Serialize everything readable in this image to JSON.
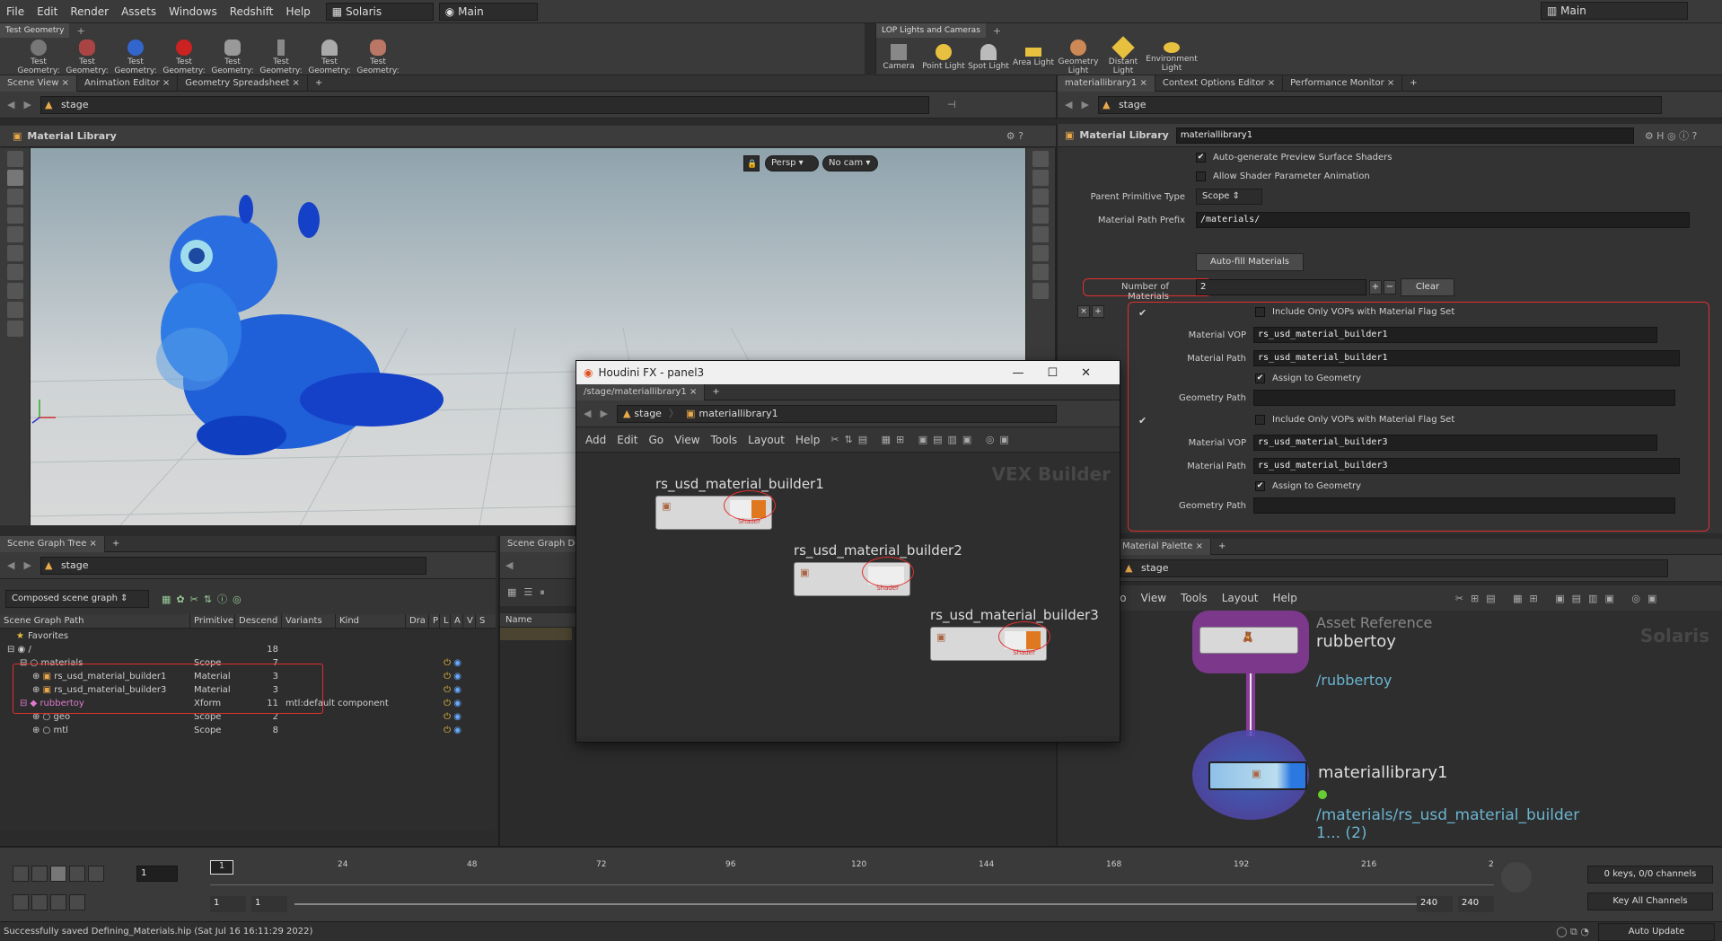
{
  "menubar": {
    "items": [
      "File",
      "Edit",
      "Render",
      "Assets",
      "Windows",
      "Redshift",
      "Help"
    ],
    "desktop": "Solaris",
    "context": "Main",
    "right_context": "Main"
  },
  "shelf_left": {
    "tab": "Test Geometry",
    "tools": [
      "Test Geometry: C...",
      "Test Geometry: P...",
      "Test Geometry: R...",
      "Test Geometry: S...",
      "Test Geometry: S...",
      "Test Geometry: T...",
      "Test Geometry: T...",
      "Test Geometry: T..."
    ]
  },
  "shelf_right": {
    "tab": "LOP Lights and Cameras",
    "tools": [
      "Camera",
      "Point Light",
      "Spot Light",
      "Area Light",
      "Geometry Light",
      "Distant Light",
      "Environment Light"
    ]
  },
  "left_tabs": [
    "Scene View",
    "Animation Editor",
    "Geometry Spreadsheet"
  ],
  "right_tabs": [
    "materiallibrary1",
    "Context Options Editor",
    "Performance Monitor"
  ],
  "viewport": {
    "path": "stage",
    "title": "Material Library",
    "persp": "Persp",
    "cam": "No cam"
  },
  "params": {
    "path": "stage",
    "node_type": "Material Library",
    "node_name": "materiallibrary1",
    "auto_gen": "Auto-generate Preview Surface Shaders",
    "allow_anim": "Allow Shader Parameter Animation",
    "parent_type_label": "Parent Primitive Type",
    "parent_type": "Scope",
    "prefix_label": "Material Path Prefix",
    "prefix": "/materials/",
    "autofill": "Auto-fill Materials",
    "num_label": "Number of Materials",
    "num": "2",
    "clear": "Clear",
    "blocks": [
      {
        "include": "Include Only VOPs with Material Flag Set",
        "vop_label": "Material VOP",
        "vop": "rs_usd_material_builder1",
        "path_label": "Material Path",
        "path": "rs_usd_material_builder1",
        "assign": "Assign to Geometry",
        "geo_label": "Geometry Path"
      },
      {
        "include": "Include Only VOPs with Material Flag Set",
        "vop_label": "Material VOP",
        "vop": "rs_usd_material_builder3",
        "path_label": "Material Path",
        "path": "rs_usd_material_builder3",
        "assign": "Assign to Geometry",
        "geo_label": "Geometry Path"
      }
    ]
  },
  "scene_graph": {
    "tab": "Scene Graph Tree",
    "path": "stage",
    "mode": "Composed scene graph",
    "cols": [
      "Scene Graph Path",
      "Primitive",
      "Descend",
      "Variants",
      "Kind",
      "Dra",
      "P",
      "L",
      "A",
      "V",
      "S"
    ],
    "favorites": "Favorites",
    "rows": [
      {
        "name": "/",
        "prim": "",
        "desc": "18",
        "kind": ""
      },
      {
        "name": "materials",
        "prim": "Scope",
        "desc": "7",
        "kind": ""
      },
      {
        "name": "rs_usd_material_builder1",
        "prim": "Material",
        "desc": "3",
        "kind": ""
      },
      {
        "name": "rs_usd_material_builder3",
        "prim": "Material",
        "desc": "3",
        "kind": ""
      },
      {
        "name": "rubbertoy",
        "prim": "Xform",
        "desc": "11",
        "kind": "mtl:default component"
      },
      {
        "name": "geo",
        "prim": "Scope",
        "desc": "2",
        "kind": ""
      },
      {
        "name": "mtl",
        "prim": "Scope",
        "desc": "8",
        "kind": ""
      }
    ]
  },
  "scene_detail": {
    "tab": "Scene Graph Deta",
    "col": "Name"
  },
  "floating": {
    "title": "Houdini FX - panel3",
    "tab": "/stage/materiallibrary1",
    "path1": "stage",
    "path2": "materiallibrary1",
    "menu": [
      "Add",
      "Edit",
      "Go",
      "View",
      "Tools",
      "Layout",
      "Help"
    ],
    "watermark": "VEX Builder",
    "shader": "Shader",
    "nodes": [
      "rs_usd_material_builder1",
      "rs_usd_material_builder2",
      "rs_usd_material_builder3"
    ]
  },
  "network": {
    "tab": "Material Palette",
    "path": "stage",
    "menu": [
      "Go",
      "View",
      "Tools",
      "Layout",
      "Help"
    ],
    "watermark": "Solaris",
    "node1_type": "Asset Reference",
    "node1_name": "rubbertoy",
    "node1_path": "/rubbertoy",
    "node2_name": "materiallibrary1",
    "node2_path1": "/materials/rs_usd_material_builder",
    "node2_path2": "1... (2)"
  },
  "timeline": {
    "frame": "1",
    "ticks": [
      "24",
      "48",
      "72",
      "96",
      "120",
      "144",
      "168",
      "192",
      "216",
      "2"
    ],
    "start": "1",
    "start2": "1",
    "end": "240",
    "end2": "240",
    "keys": "0 keys, 0/0 channels",
    "keyall": "Key All Channels",
    "update": "Auto Update"
  },
  "status": "Successfully saved Defining_Materials.hip (Sat Jul 16 16:11:29 2022)",
  "colors": {
    "red": "#e03030",
    "purple": "#8a3a9a",
    "toyblue": "#1f5fd8"
  }
}
